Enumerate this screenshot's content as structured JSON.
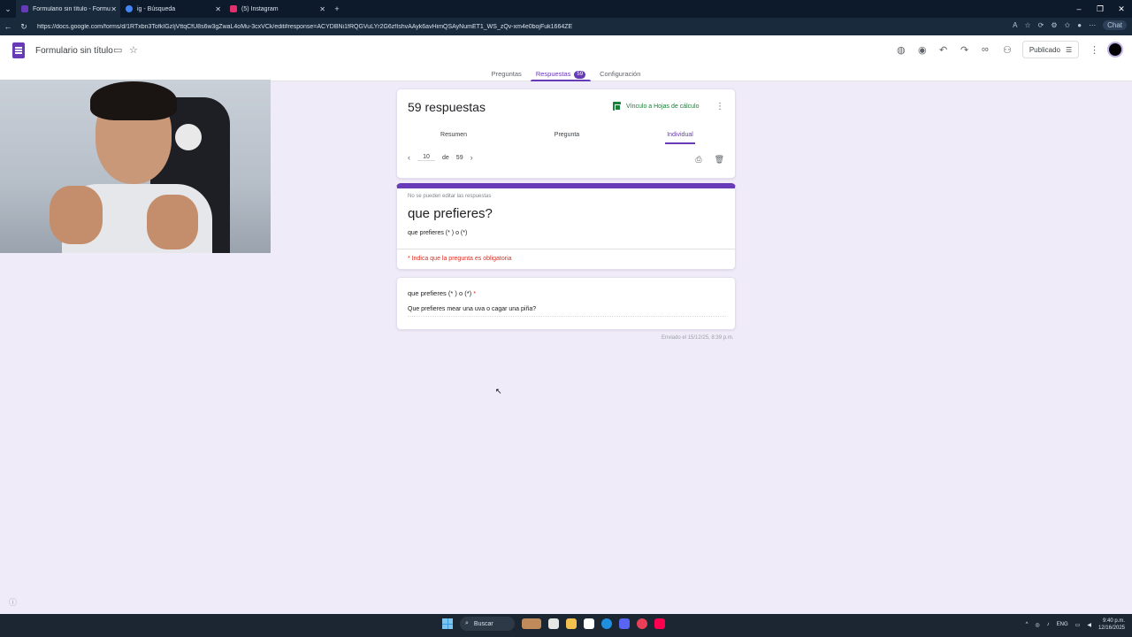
{
  "browser": {
    "tabs": [
      {
        "label": "Formulario sin título - Formulario",
        "active": true,
        "color": "#673ab7"
      },
      {
        "label": "ig - Búsqueda",
        "active": false,
        "color": "#4285f4"
      },
      {
        "label": "(5) Instagram",
        "active": false,
        "color": "#e1306c"
      }
    ],
    "url": "https://docs.google.com/forms/d/1RTxbn3TofkIGzIjVttqCfU8s6w3gZwaL4oMu-3cxVCk/edit#response=ACYDBNi1fRQGVuLYr2G6zfIshvAAyk6avHimQSAyNumET1_WS_zQv-xm4e0bojFuk1664ZE",
    "chat_label": "Chat"
  },
  "header": {
    "doc_title": "Formulario sin título",
    "publish_label": "Publicado",
    "accent": "#673ab7"
  },
  "main_tabs": [
    {
      "label": "Preguntas",
      "active": false
    },
    {
      "label": "Respuestas",
      "active": true,
      "badge": "59"
    },
    {
      "label": "Configuración",
      "active": false
    }
  ],
  "summary": {
    "count_label": "59 respuestas",
    "sheets_link": "Vínculo a Hojas de cálculo",
    "subtabs": [
      "Resumen",
      "Pregunta",
      "Individual"
    ],
    "active_subtab": "Individual",
    "pager": {
      "current": "10",
      "of_label": "de",
      "total": "59"
    }
  },
  "form": {
    "no_edit_notice": "No se pueden editar las respuestas",
    "title": "que prefieres?",
    "description": "que prefieres (* ) o (*)",
    "required_notice": "* Indica que la pregunta es obligatoria"
  },
  "question": {
    "label": "que prefieres (* ) o (*)",
    "required_mark": "*",
    "answer": "Que prefieres mear una uva o cagar una piña?"
  },
  "sent_label": "Enviado el 15/12/25, 8:39 p.m.",
  "taskbar": {
    "search_label": "Buscar",
    "lang": "ENG",
    "time": "9:40 p.m.",
    "date": "12/16/2025"
  }
}
